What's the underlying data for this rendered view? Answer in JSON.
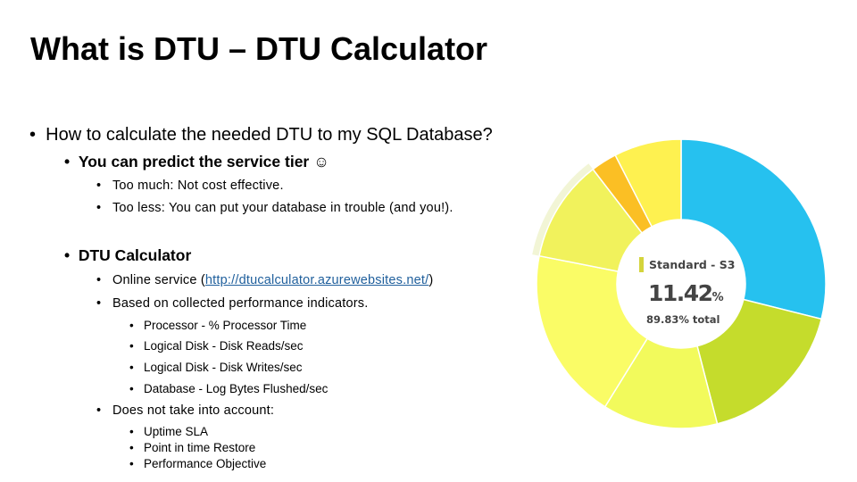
{
  "title": "What is DTU – DTU Calculator",
  "bullets": {
    "q": "How to calculate the needed DTU to my SQL Database?",
    "predict": "You can predict the service tier",
    "smiley": "☺",
    "too_much": "Too much: Not cost effective.",
    "too_less": "Too less: You can put your database in trouble (and you!).",
    "calc": "DTU Calculator",
    "online_prefix": "Online service (",
    "online_link": "http://dtucalculator.azurewebsites.net/",
    "online_suffix": ")",
    "based": "Based on collected performance indicators.",
    "indicators": [
      "Processor - % Processor Time",
      "Logical Disk - Disk Reads/sec",
      "Logical Disk - Disk Writes/sec",
      "Database - Log Bytes Flushed/sec"
    ],
    "not_account": "Does not take into account:",
    "not_items": [
      "Uptime SLA",
      "Point in time Restore",
      "Performance Objective"
    ]
  },
  "chart_data": {
    "type": "pie",
    "donut": true,
    "center_label": "Standard - S3",
    "center_value": "11.42",
    "center_unit": "%",
    "center_total": "89.83% total",
    "highlighted": "Standard - S3",
    "slices": [
      {
        "value": 28.8,
        "color": "#26c1ef"
      },
      {
        "value": 17.0,
        "color": "#c5dc2c"
      },
      {
        "value": 12.8,
        "color": "#f2fa5c"
      },
      {
        "value": 19.2,
        "color": "#fafc66"
      },
      {
        "name": "Standard - S3",
        "value": 11.42,
        "color": "#f1f25c"
      },
      {
        "value": 2.9,
        "color": "#fbbf24"
      },
      {
        "value": 7.5,
        "color": "#fef150"
      }
    ]
  }
}
